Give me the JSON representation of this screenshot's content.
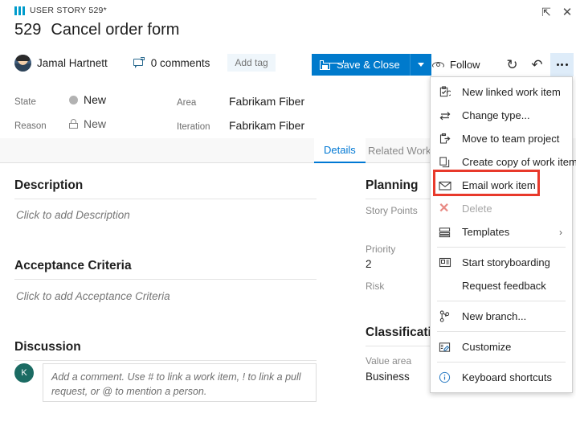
{
  "header": {
    "work_item_type": "USER STORY 529*",
    "work_item_icon": "user-story-icon",
    "id": "529",
    "title": "Cancel order form",
    "assigned_to": "Jamal Hartnett",
    "comments_label": "0 comments",
    "add_tag_label": "Add tag",
    "collapse_icon": "collapse-icon",
    "close_icon": "close-icon"
  },
  "toolbar": {
    "save_close_label": "Save & Close",
    "save_icon": "save-icon",
    "split_caret_icon": "chevron-down-icon",
    "follow_label": "Follow",
    "follow_icon": "eye-icon",
    "refresh_icon": "refresh-icon",
    "undo_icon": "undo-icon",
    "more_icon": "more-ellipsis-icon",
    "accent_color": "#007acc"
  },
  "fields": {
    "state_label": "State",
    "state_value": "New",
    "state_dot_color": "#b2b2b2",
    "reason_label": "Reason",
    "reason_value": "New",
    "reason_icon": "lock-icon",
    "area_label": "Area",
    "area_value": "Fabrikam Fiber",
    "iteration_label": "Iteration",
    "iteration_value": "Fabrikam Fiber"
  },
  "tabs": [
    {
      "label": "Details",
      "active": true
    },
    {
      "label": "Related Work it",
      "active": false
    }
  ],
  "main": {
    "description_heading": "Description",
    "description_placeholder": "Click to add Description",
    "acceptance_heading": "Acceptance Criteria",
    "acceptance_placeholder": "Click to add Acceptance Criteria",
    "discussion_heading": "Discussion",
    "discussion_avatar_initial": "K",
    "discussion_placeholder": "Add a comment. Use # to link a work item, ! to link a pull request, or @ to mention a person."
  },
  "right_panel": {
    "planning_heading": "Planning",
    "story_points_label": "Story Points",
    "story_points_value": "",
    "priority_label": "Priority",
    "priority_value": "2",
    "risk_label": "Risk",
    "classification_heading": "Classificati",
    "value_area_label": "Value area",
    "value_area_value": "Business"
  },
  "context_menu": {
    "highlight_color": "#e8392b",
    "items": [
      {
        "label": "New linked work item",
        "icon": "linked-work-item-icon",
        "disabled": false,
        "highlighted": false,
        "submenu": false
      },
      {
        "label": "Change type...",
        "icon": "change-type-icon",
        "disabled": false,
        "highlighted": false,
        "submenu": false
      },
      {
        "label": "Move to team project",
        "icon": "move-icon",
        "disabled": false,
        "highlighted": false,
        "submenu": false
      },
      {
        "label": "Create copy of work item...",
        "icon": "copy-icon",
        "disabled": false,
        "highlighted": false,
        "submenu": false
      },
      {
        "label": "Email work item",
        "icon": "email-icon",
        "disabled": false,
        "highlighted": true,
        "submenu": false
      },
      {
        "label": "Delete",
        "icon": "delete-x-icon",
        "disabled": true,
        "highlighted": false,
        "submenu": false
      },
      {
        "label": "Templates",
        "icon": "templates-icon",
        "disabled": false,
        "highlighted": false,
        "submenu": true
      },
      {
        "label": "Start storyboarding",
        "icon": "storyboard-icon",
        "disabled": false,
        "highlighted": false,
        "submenu": false
      },
      {
        "label": "Request feedback",
        "icon": "",
        "disabled": false,
        "highlighted": false,
        "submenu": false
      },
      {
        "label": "New branch...",
        "icon": "branch-icon",
        "disabled": false,
        "highlighted": false,
        "submenu": false
      },
      {
        "label": "Customize",
        "icon": "customize-icon",
        "disabled": false,
        "highlighted": false,
        "submenu": false
      },
      {
        "label": "Keyboard shortcuts",
        "icon": "info-icon",
        "disabled": false,
        "highlighted": false,
        "submenu": false
      }
    ]
  }
}
